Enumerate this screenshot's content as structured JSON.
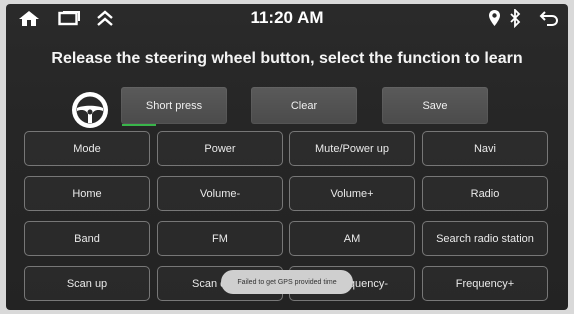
{
  "status_bar": {
    "time": "11:20 AM",
    "icons": [
      "home-icon",
      "recent-apps-icon",
      "chevrons-up-icon",
      "location-icon",
      "bluetooth-icon",
      "back-icon"
    ]
  },
  "title": "Release the steering wheel button, select the function to learn",
  "actions": {
    "short_press": "Short press",
    "clear": "Clear",
    "save": "Save"
  },
  "functions": [
    [
      "Mode",
      "Power",
      "Mute/Power up",
      "Navi"
    ],
    [
      "Home",
      "Volume-",
      "Volume+",
      "Radio"
    ],
    [
      "Band",
      "FM",
      "AM",
      "Search radio station"
    ],
    [
      "Scan up",
      "Scan down",
      "Frequency-",
      "Frequency+"
    ]
  ],
  "toast": "Failed to get GPS provided time",
  "colors": {
    "accent_underline": "#39b54a"
  }
}
